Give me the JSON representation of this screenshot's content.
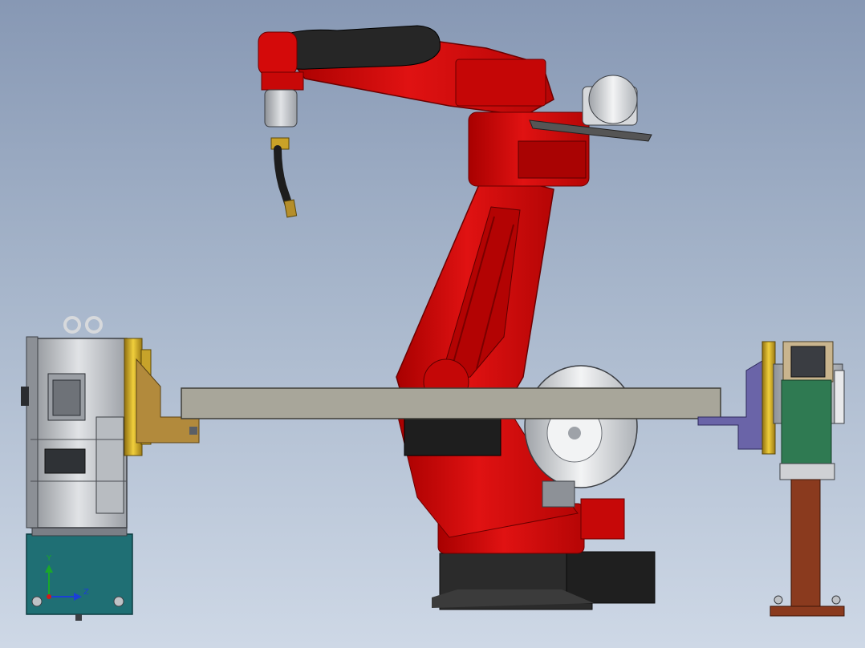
{
  "viewport": {
    "background_top": "#8798b4",
    "background_bottom": "#ced8e6"
  },
  "colors": {
    "robot_red": "#d40a0a",
    "robot_dark": "#2b2b2b",
    "positioner_gray": "#c9ccd1",
    "base_teal": "#1f6f74",
    "gold_flange": "#d4b12a",
    "bracket_tan": "#b28a3c",
    "bracket_purple": "#6a64a8",
    "pedestal_brown": "#8a3a1e",
    "support_green": "#2f7a52",
    "plate_gray": "#a8a69a"
  },
  "axis_triad": {
    "y_label": "Y",
    "z_label": "Z",
    "y_color": "#1aa82a",
    "z_color": "#1b3fd6",
    "x_color": "#d11a1a"
  }
}
